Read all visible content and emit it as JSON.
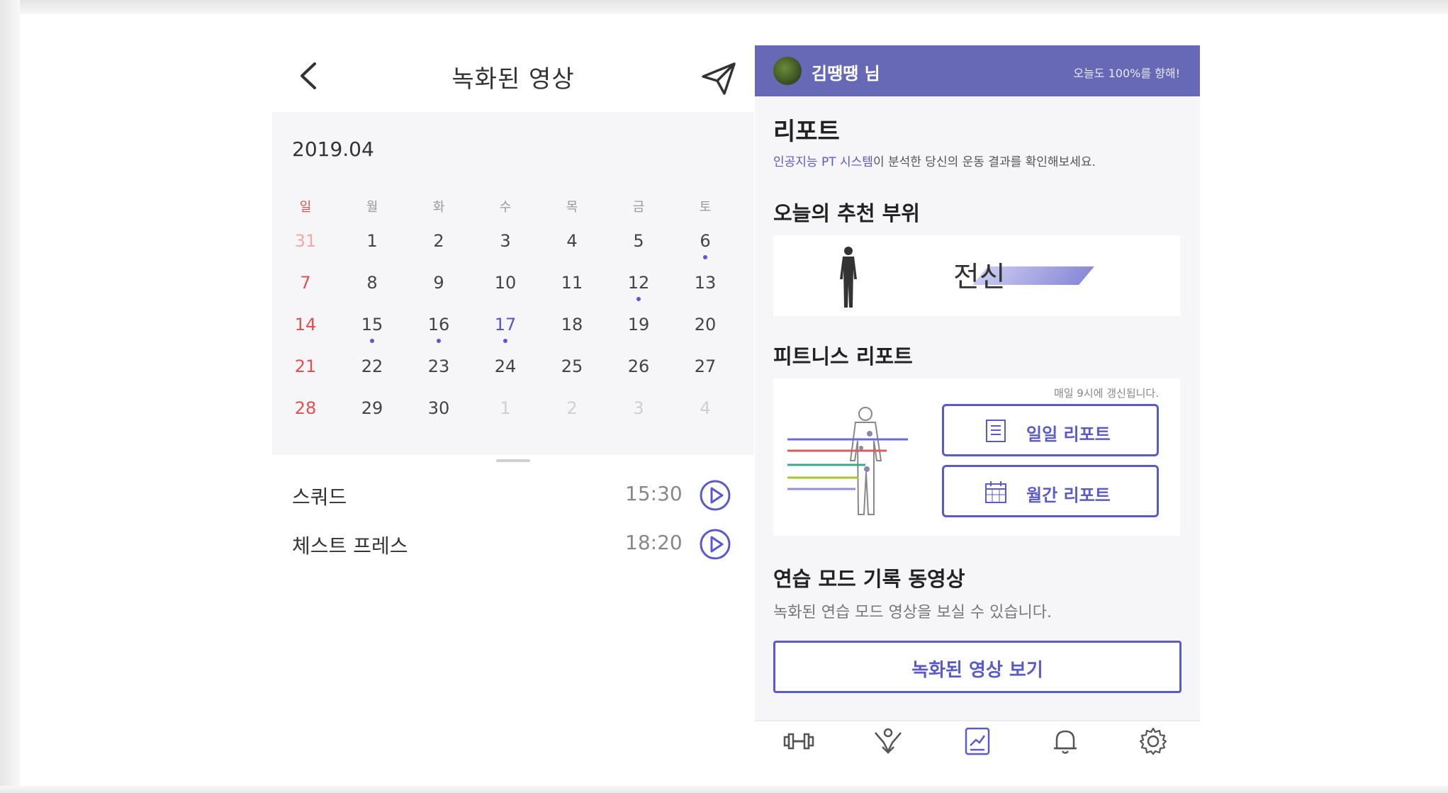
{
  "left_screen": {
    "title": "녹화된 영상",
    "month": "2019.04",
    "weekdays": [
      "일",
      "월",
      "화",
      "수",
      "목",
      "금",
      "토"
    ],
    "weeks": [
      [
        "31",
        "1",
        "2",
        "3",
        "4",
        "5",
        "6"
      ],
      [
        "7",
        "8",
        "9",
        "10",
        "11",
        "12",
        "13"
      ],
      [
        "14",
        "15",
        "16",
        "17",
        "18",
        "19",
        "20"
      ],
      [
        "21",
        "22",
        "23",
        "24",
        "25",
        "26",
        "27"
      ],
      [
        "28",
        "29",
        "30",
        "1",
        "2",
        "3",
        "4"
      ]
    ],
    "videos": [
      {
        "name": "스쿼드",
        "time": "15:30"
      },
      {
        "name": "체스트 프레스",
        "time": "18:20"
      }
    ]
  },
  "right_screen": {
    "user_name": "김땡땡 님",
    "motto": "오늘도 100%를 향해!",
    "report_title": "리포트",
    "subtitle_highlight": "인공지능 PT 시스템",
    "subtitle_rest": "이 분석한 당신의 운동 결과를 확인해보세요.",
    "recommend_title": "오늘의 추천 부위",
    "recommend_part": "전신",
    "fitness_title": "피트니스 리포트",
    "update_note": "매일 9시에 갱신됩니다.",
    "daily_report": "일일 리포트",
    "monthly_report": "월간 리포트",
    "practice_title": "연습 모드 기록 동영상",
    "practice_desc": "녹화된 연습 모드 영상을 보실 수 있습니다.",
    "view_button": "녹화된 영상 보기"
  },
  "colors": {
    "accent": "#5a5ac8",
    "header": "#6768b6",
    "sunday": "#e25050"
  },
  "icons": [
    "back-arrow-icon",
    "send-icon",
    "play-icon",
    "dumbbell-icon",
    "stretch-icon",
    "report-icon",
    "bell-icon",
    "settings-icon"
  ]
}
